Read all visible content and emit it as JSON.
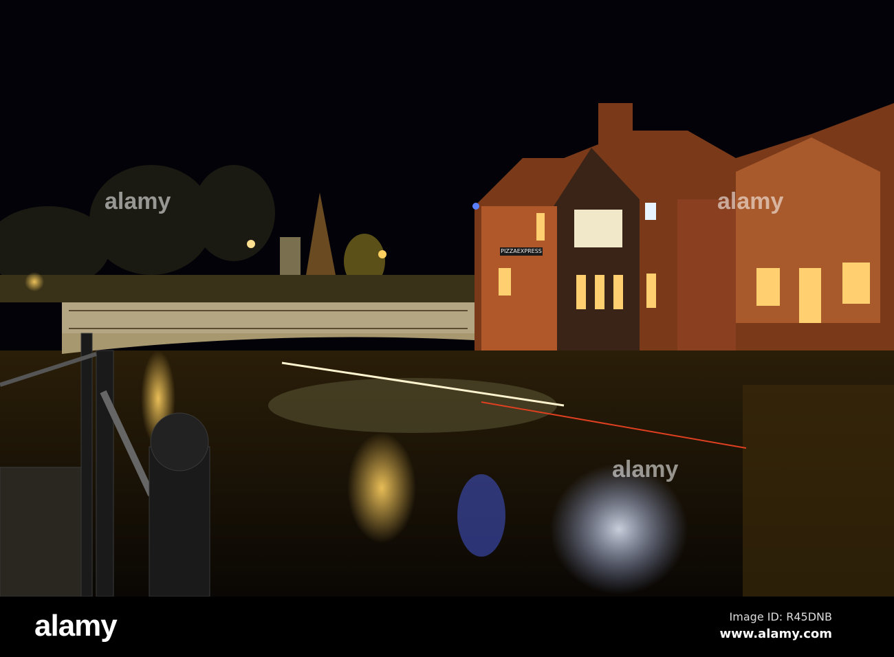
{
  "photo": {
    "subject": "River with illuminated bridge and brick buildings at night",
    "sign_text": "PIZZAEXPRESS",
    "watermark": "alamy"
  },
  "footer": {
    "logo": "alamy",
    "image_id": "Image ID: R45DNB",
    "website": "www.alamy.com"
  }
}
